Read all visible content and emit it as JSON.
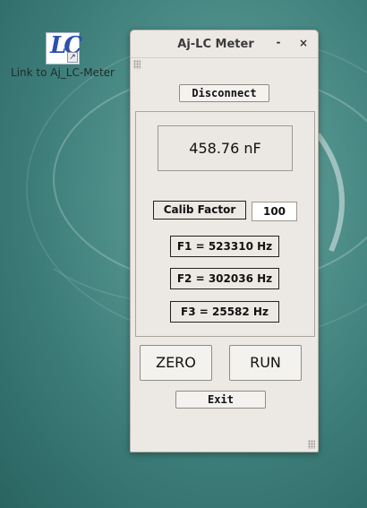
{
  "desktop": {
    "icon": {
      "glyph": "LC",
      "link_glyph": "↗",
      "label": "Link to Aj_LC-Meter",
      "icon_name": "lc-meter-app-icon"
    }
  },
  "window": {
    "title": "Aj-LC Meter",
    "minimize_glyph": "-",
    "close_glyph": "×",
    "disconnect_label": "Disconnect",
    "reading": "458.76 nF",
    "calib_factor_label": "Calib Factor",
    "calib_factor_value": "100",
    "f1": "F1 = 523310 Hz",
    "f2": "F2 = 302036 Hz",
    "f3": "F3 = 25582 Hz",
    "zero_label": "ZERO",
    "run_label": "RUN",
    "exit_label": "Exit"
  },
  "colors": {
    "desktop_teal": "#4f8f8a",
    "window_bg": "#ece9e4"
  }
}
